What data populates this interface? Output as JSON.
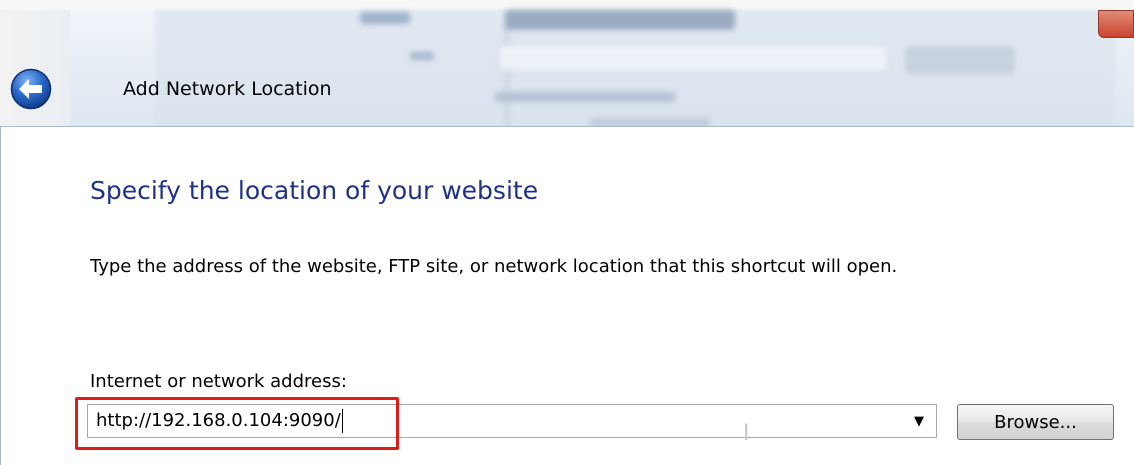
{
  "window": {
    "title": "Add Network Location"
  },
  "page": {
    "main_instruction": "Specify the location of your website",
    "description": "Type the address of the website, FTP site, or network location that this shortcut will open.",
    "address_label": "Internet or network address:",
    "address_value": "http://192.168.0.104:9090/",
    "browse_label": "Browse..."
  },
  "icons": {
    "back": "back-arrow-icon",
    "dropdown": "chevron-down-icon"
  },
  "colors": {
    "main_instruction": "#1e3287",
    "highlight": "#e01b1b",
    "back_button": "#2a69c9"
  }
}
